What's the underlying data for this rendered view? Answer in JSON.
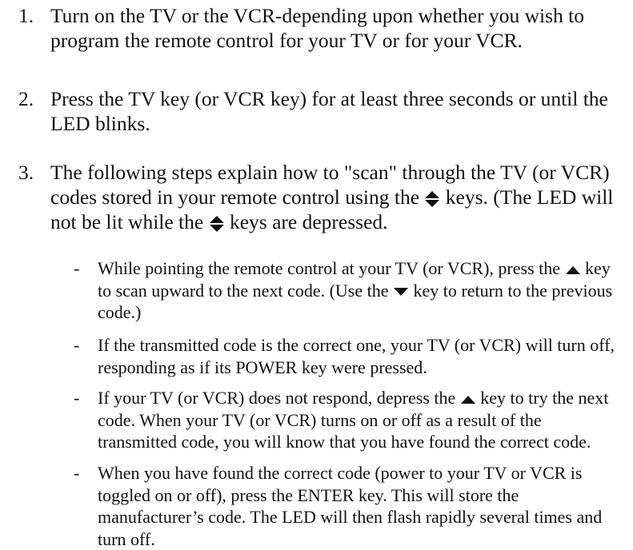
{
  "steps": [
    {
      "number": "1.",
      "text": "Turn on the TV or the VCR-depending upon whether you wish to program the remote control for your TV or for your VCR."
    },
    {
      "number": "2.",
      "text": "Press the TV key (or VCR key) for at least three seconds or until the LED blinks."
    },
    {
      "number": "3.",
      "text_a": "The following steps explain how to \"scan\" through the TV (or VCR) codes stored in your remote control using the",
      "text_b": "keys. (The LED will not be lit while the",
      "text_c": "keys are depressed."
    }
  ],
  "substeps": [
    {
      "dash": "-",
      "text_a": "While pointing the remote control at your TV (or VCR), press the",
      "text_b": "key to scan upward to the next code. (Use the",
      "text_c": "key to return to the previous code.)"
    },
    {
      "dash": "-",
      "text": "If the transmitted code is the correct one, your TV (or VCR) will turn off, responding as if its POWER key were pressed."
    },
    {
      "dash": "-",
      "text_a": "If your TV (or VCR) does not respond, depress the",
      "text_b": "key to try the next code. When your TV (or VCR) turns on or off as a result of the transmitted code, you will know that you have found the correct code."
    },
    {
      "dash": "-",
      "text": "When you have found the correct code (power to your TV or VCR is toggled on or off), press the ENTER key. This will store the manufacturer’s code. The LED will then flash rapidly several times and turn off."
    }
  ],
  "icons": {
    "updown": "up-down-arrow-icon",
    "up": "up-arrow-icon",
    "down": "down-arrow-icon"
  }
}
